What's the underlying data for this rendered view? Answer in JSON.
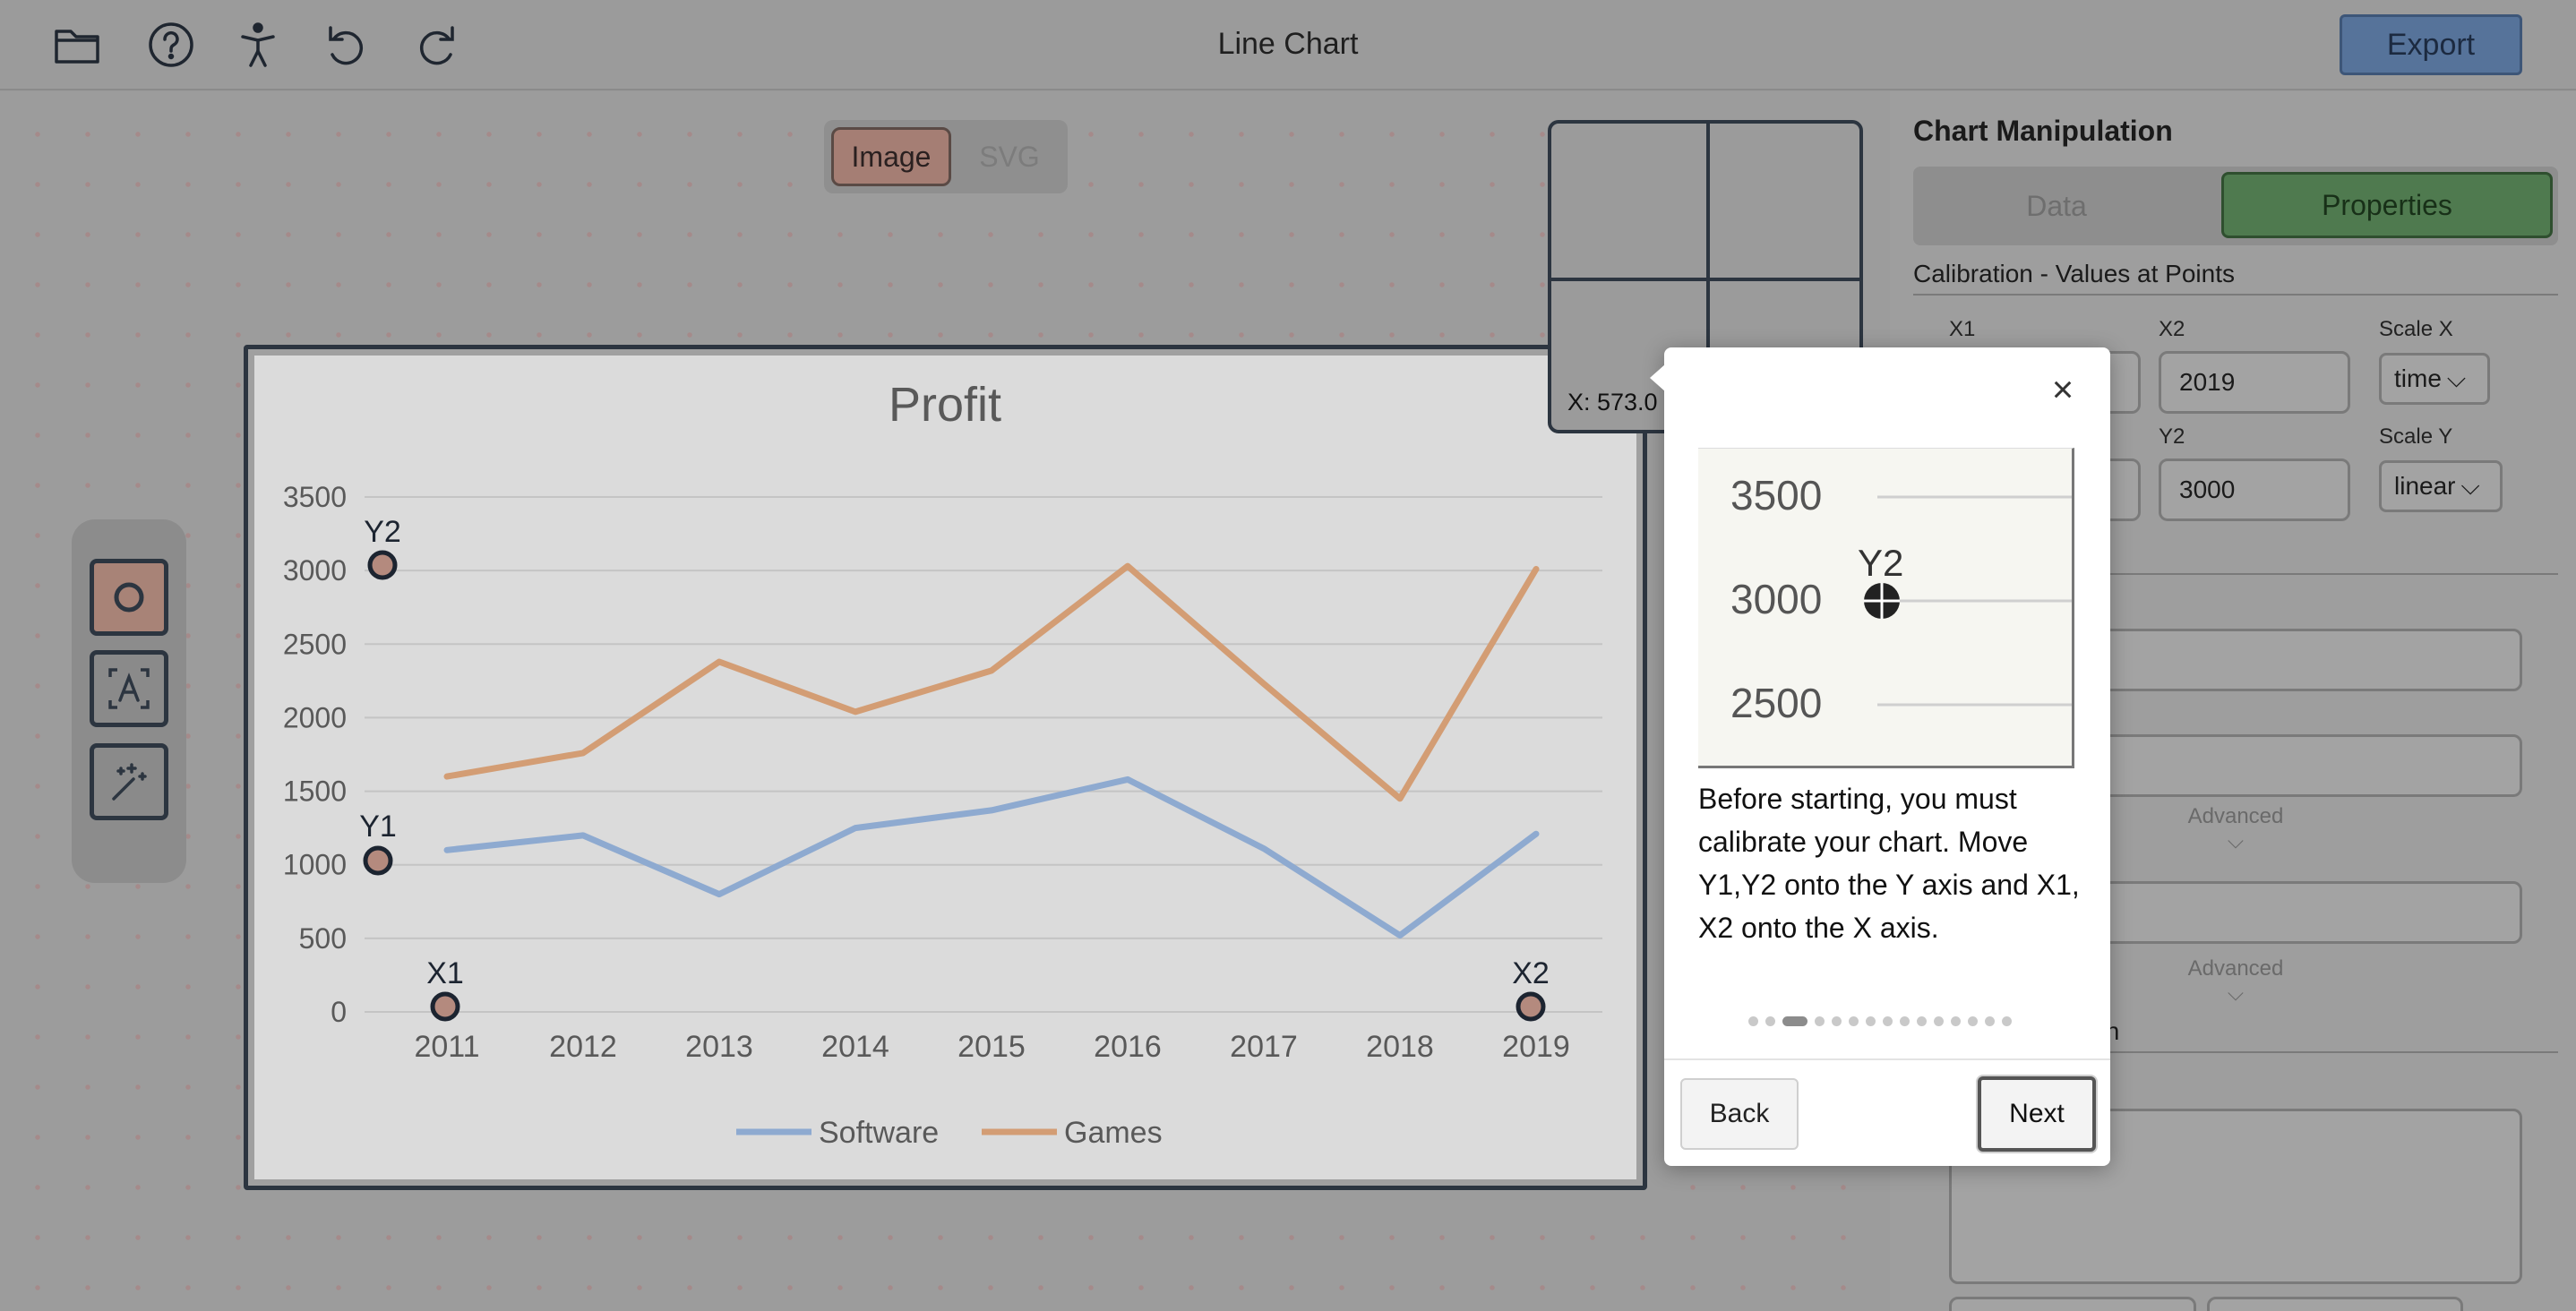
{
  "header": {
    "title": "Line Chart",
    "export_label": "Export",
    "icons": [
      "folder-icon",
      "help-icon",
      "accessibility-icon",
      "undo-icon",
      "redo-icon"
    ]
  },
  "view_toggle": {
    "image_label": "Image",
    "svg_label": "SVG",
    "selected": "Image"
  },
  "toolbox": {
    "tools": [
      "point-tool-icon",
      "text-tool-icon",
      "magic-wand-icon"
    ],
    "active": "point-tool-icon"
  },
  "magnifier": {
    "readout": "X: 573.0"
  },
  "calibration_markers": [
    "Y2",
    "Y1",
    "X1",
    "X2"
  ],
  "chart_data": {
    "type": "line",
    "title": "Profit",
    "xlabel": "",
    "ylabel": "",
    "categories": [
      "2011",
      "2012",
      "2013",
      "2014",
      "2015",
      "2016",
      "2017",
      "2018",
      "2019"
    ],
    "ylim": [
      0,
      3500
    ],
    "yticks": [
      "0",
      "500",
      "1000",
      "1500",
      "2000",
      "2500",
      "3000",
      "3500"
    ],
    "grid": true,
    "legend": "bottom",
    "series": [
      {
        "name": "Software",
        "color": "#8eaad0",
        "values": [
          1100,
          1200,
          800,
          1250,
          1370,
          1580,
          1110,
          520,
          1210
        ]
      },
      {
        "name": "Games",
        "color": "#d39d74",
        "values": [
          1600,
          1760,
          2380,
          2040,
          2320,
          3030,
          2230,
          1450,
          3010
        ]
      }
    ]
  },
  "panel": {
    "title": "Chart Manipulation",
    "tab_data": "Data",
    "tab_properties": "Properties",
    "active_tab": "Properties",
    "calibration_heading": "Calibration - Values at Points",
    "x1_label": "X1",
    "x2_label": "X2",
    "x2_value": "2019",
    "scale_x_label": "Scale X",
    "scale_x_value": "time",
    "y2_label": "Y2",
    "y2_value": "3000",
    "scale_y_label": "Scale Y",
    "scale_y_value": "linear",
    "section2_fragment": "n",
    "advanced_label": "Advanced",
    "section3_fragment": "nation"
  },
  "tutorial": {
    "close_label": "×",
    "preview_ticks": [
      "3500",
      "3000",
      "2500"
    ],
    "preview_marker": "Y2",
    "text": "Before starting, you must calibrate your chart. Move Y1,Y2 onto the Y axis and X1, X2 onto the X axis.",
    "step": 3,
    "total_steps": 15,
    "back_label": "Back",
    "next_label": "Next"
  }
}
